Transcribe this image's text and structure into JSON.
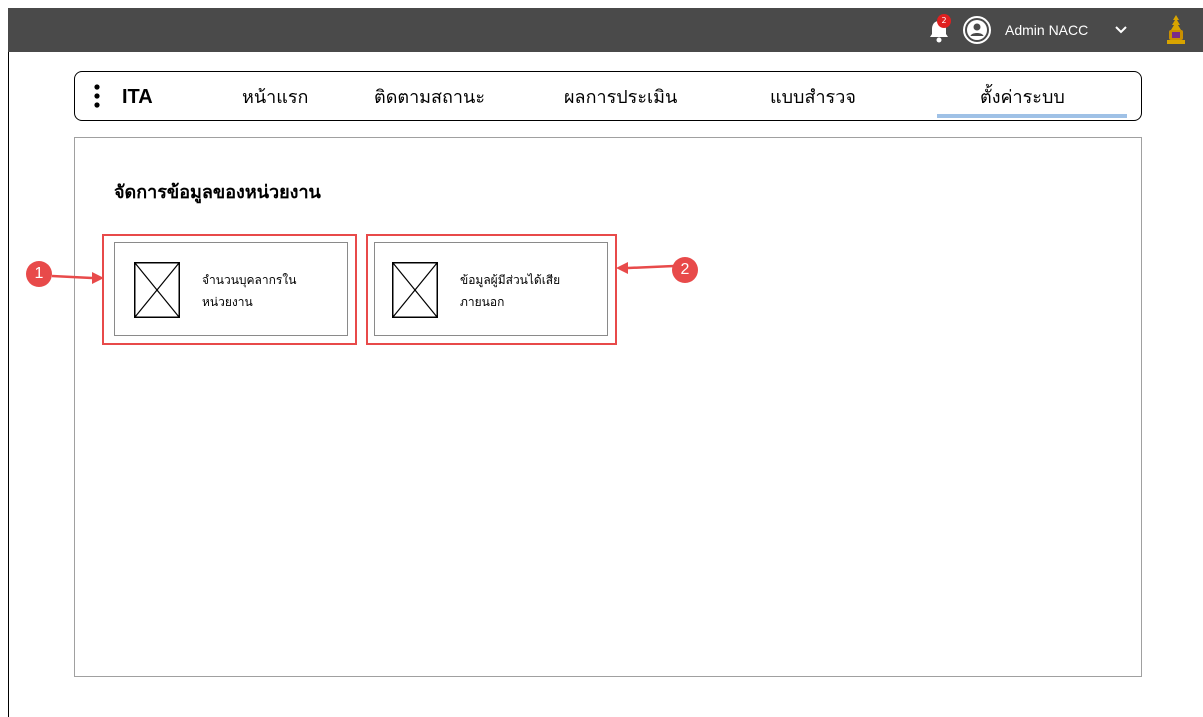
{
  "header": {
    "notification_count": "2",
    "user_name": "Admin NACC"
  },
  "nav": {
    "brand": "ITA",
    "items": [
      {
        "label": "หน้าแรก"
      },
      {
        "label": "ติดตามสถานะ"
      },
      {
        "label": "ผลการประเมิน"
      },
      {
        "label": "แบบสำรวจ"
      },
      {
        "label": "ตั้งค่าระบบ",
        "active": true
      }
    ]
  },
  "main": {
    "title": "จัดการข้อมูลของหน่วยงาน",
    "cards": [
      {
        "line1": "จำนวนบุคลากรใน",
        "line2": "หน่วยงาน"
      },
      {
        "line1": "ข้อมูลผู้มีส่วนได้เสีย",
        "line2": "ภายนอก"
      }
    ]
  },
  "annotations": {
    "marker1": "1",
    "marker2": "2"
  },
  "colors": {
    "topbar": "#4a4a4a",
    "highlight": "#e84a4a",
    "active_underline": "#9fc1e6",
    "badge": "#e02020"
  }
}
